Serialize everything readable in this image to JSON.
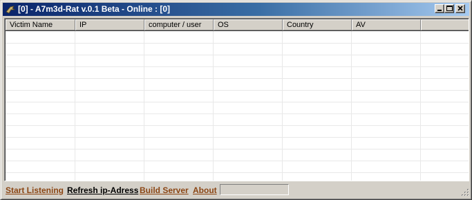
{
  "window": {
    "title": "[0] - A7m3d-Rat v.0.1 Beta - Online : [0]"
  },
  "listview": {
    "columns": [
      "Victim Name",
      "IP",
      "computer / user",
      "OS",
      "Country",
      "AV",
      ""
    ]
  },
  "statusbar": {
    "start_listening": "Start Listening",
    "refresh_ip": "Refresh ip-Adress",
    "build_server": "Build Server",
    "about": "About",
    "progress": 0
  },
  "colors": {
    "title_gradient_start": "#0a246a",
    "title_gradient_end": "#a6caf0",
    "link_brown": "#8b4513",
    "link_black": "#000000"
  }
}
